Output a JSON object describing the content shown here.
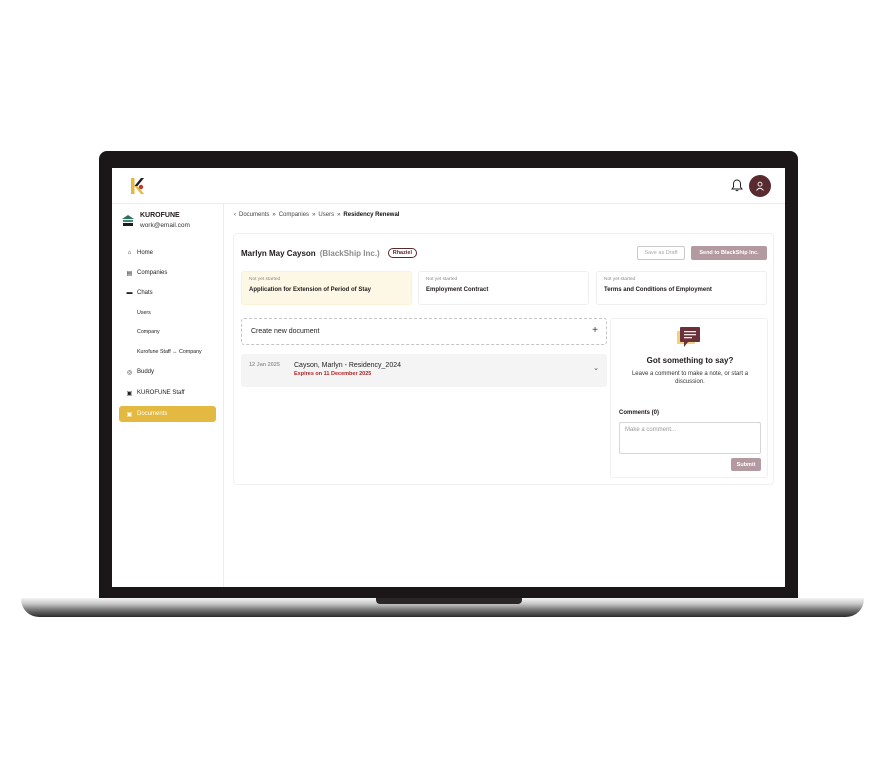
{
  "topbar": {
    "logo": "kurofune-logo",
    "bell": "bell-icon",
    "avatar": "user-icon"
  },
  "sidebar": {
    "org_name": "KUROFUNE",
    "org_email": "work@email.com",
    "items": [
      {
        "label": "Home",
        "icon": "home-icon"
      },
      {
        "label": "Companies",
        "icon": "building-icon"
      },
      {
        "label": "Chats",
        "icon": "chat-icon"
      },
      {
        "label": "Users",
        "icon": ""
      },
      {
        "label": "Company",
        "icon": ""
      },
      {
        "label": "Kurofune Staff ↔ Company",
        "icon": ""
      },
      {
        "label": "Buddy",
        "icon": "buddy-icon"
      },
      {
        "label": "KUROFUNE Staff",
        "icon": "staff-icon"
      },
      {
        "label": "Documents",
        "icon": "document-icon"
      }
    ]
  },
  "breadcrumb": {
    "back": "‹",
    "items": [
      "Documents",
      "Companies",
      "Users"
    ],
    "separator": "»",
    "current": "Residency Renewal"
  },
  "header": {
    "name": "Marlyn May Cayson",
    "company": "(BlackShip Inc.)",
    "tag": "Rhaziel",
    "save_draft": "Save as Draft",
    "send": "Send to BlackShip Inc."
  },
  "cards": [
    {
      "status": "Not yet started",
      "title": "Application for Extension of Period of Stay"
    },
    {
      "status": "Not yet started",
      "title": "Employment Contract"
    },
    {
      "status": "Not yet started",
      "title": "Terms and Conditions of Employment"
    }
  ],
  "new_document": {
    "label": "Create new document",
    "icon": "+"
  },
  "document": {
    "date": "12 Jan 2025",
    "name": "Cayson, Marlyn - Residency_2024",
    "expires": "Expires on 11 December 2025",
    "chevron": "⌄"
  },
  "comments": {
    "title": "Got something to say?",
    "subtitle": "Leave a comment to make a note, or start a discussion.",
    "count_label": "Comments (0)",
    "placeholder": "Make a comment...",
    "submit": "Submit"
  },
  "colors": {
    "accent": "#e3b942",
    "brand": "#5a2a31",
    "muted_button": "#b39aa0",
    "expiry": "#b22222"
  }
}
